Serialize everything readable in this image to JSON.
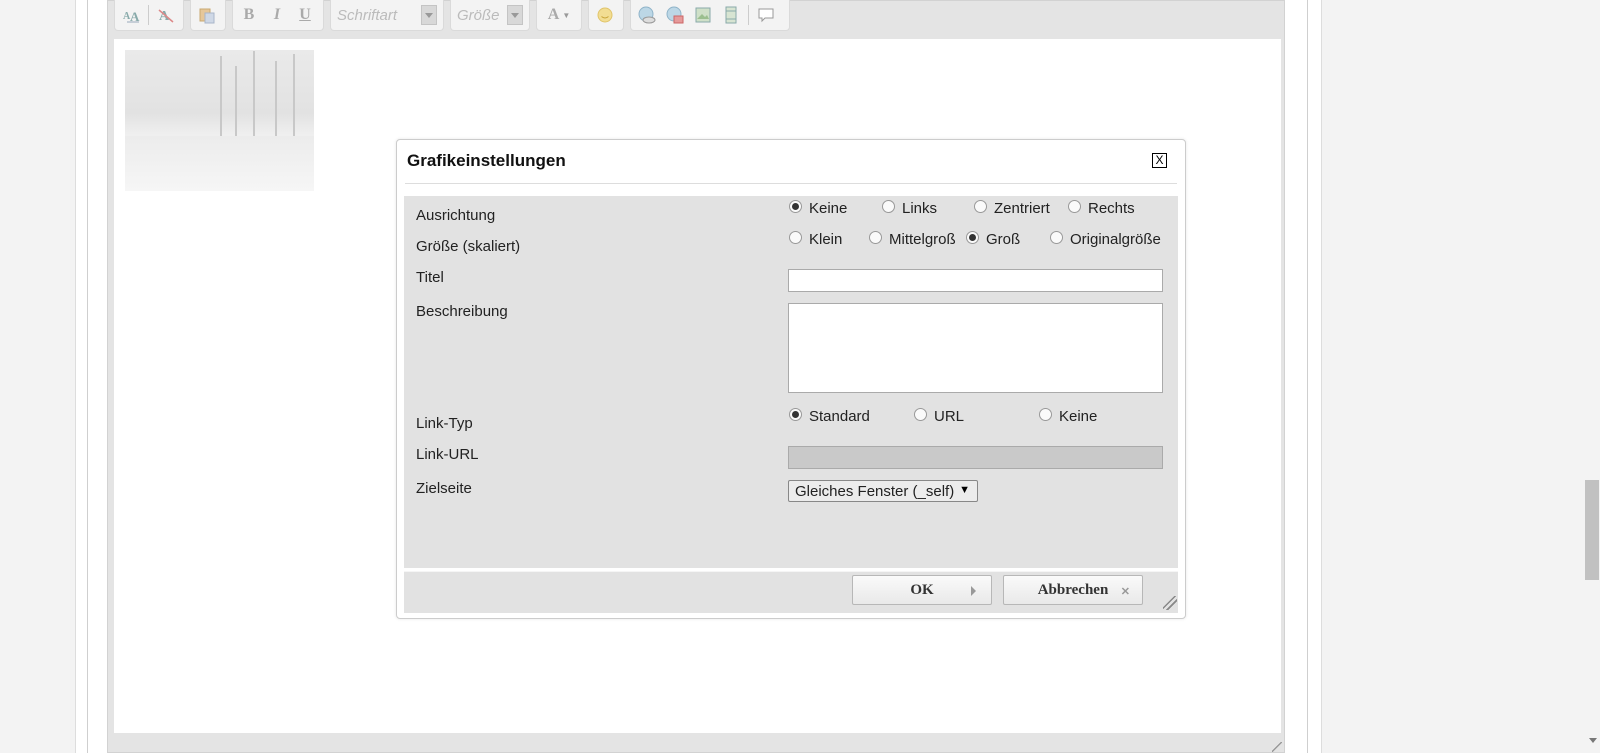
{
  "toolbar": {
    "font_placeholder": "Schriftart",
    "size_placeholder": "Größe",
    "buttons": {
      "bold": "B",
      "italic": "I",
      "underline": "U",
      "font_color": "A"
    }
  },
  "dialog": {
    "title": "Grafikeinstellungen",
    "close_label": "X",
    "alignment": {
      "label": "Ausrichtung",
      "options": [
        "Keine",
        "Links",
        "Zentriert",
        "Rechts"
      ],
      "selected": "Keine"
    },
    "size": {
      "label": "Größe (skaliert)",
      "options": [
        "Klein",
        "Mittelgroß",
        "Groß",
        "Originalgröße"
      ],
      "selected": "Groß"
    },
    "title_field": {
      "label": "Titel",
      "value": ""
    },
    "description_field": {
      "label": "Beschreibung",
      "value": ""
    },
    "link_type": {
      "label": "Link-Typ",
      "options": [
        "Standard",
        "URL",
        "Keine"
      ],
      "selected": "Standard"
    },
    "link_url": {
      "label": "Link-URL",
      "value": ""
    },
    "target": {
      "label": "Zielseite",
      "selected": "Gleiches Fenster (_self)"
    },
    "ok_label": "OK",
    "cancel_label": "Abbrechen"
  },
  "colors": {
    "dialog_body": "#e2e2e2",
    "editor_frame": "#e4e4e4"
  }
}
